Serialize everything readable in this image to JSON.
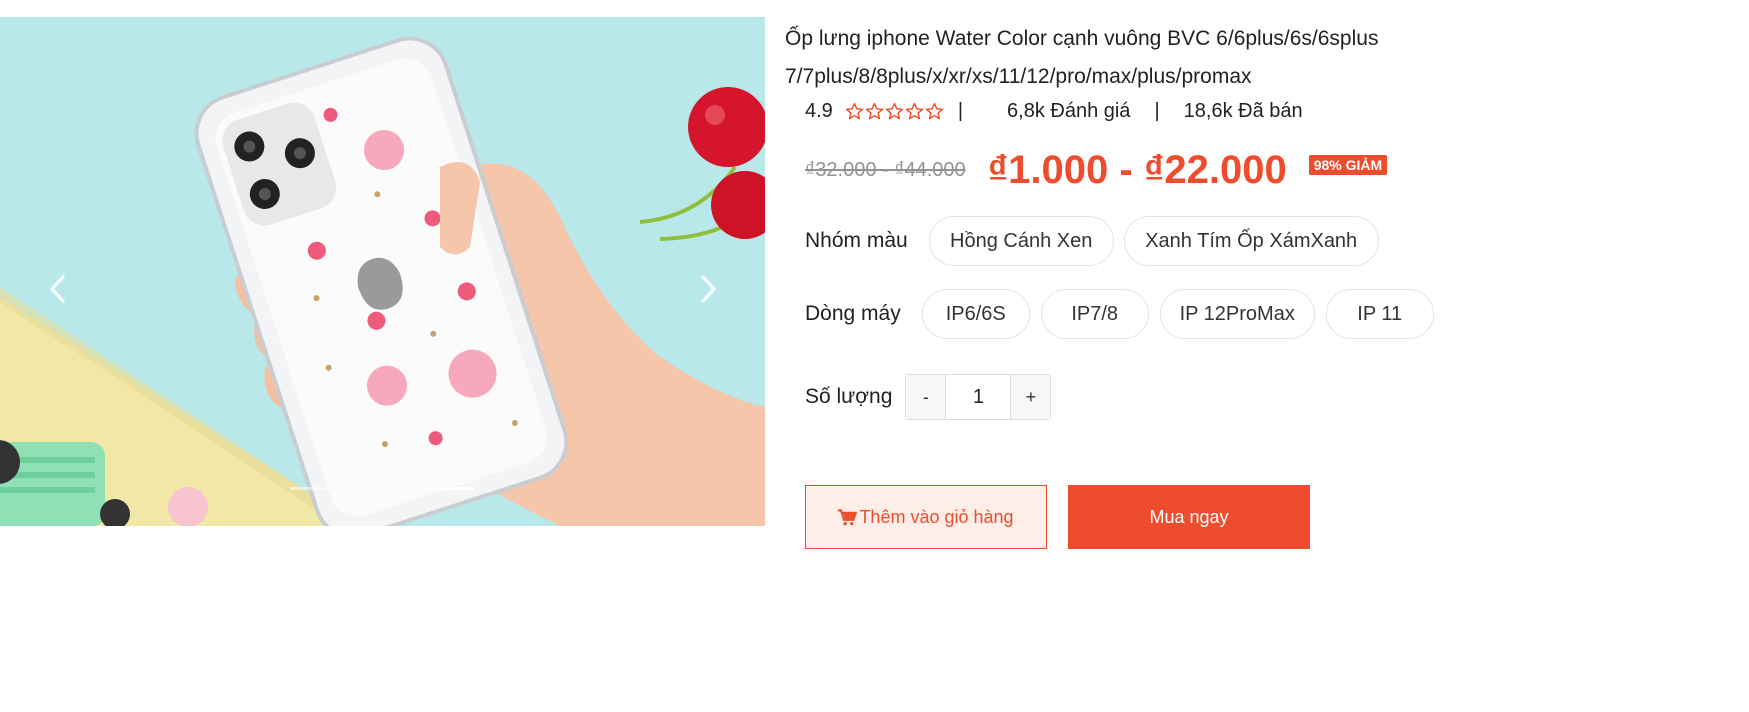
{
  "product": {
    "title": "Ốp lưng iphone Water Color cạnh vuông BVC 6/6plus/6s/6splus 7/7plus/8/8plus/x/xr/xs/11/12/pro/max/plus/promax",
    "rating": "4.9",
    "stars_count": 5,
    "separator": "|",
    "reviews": "6,8k Đánh giá",
    "sold": "18,6k Đã bán",
    "old_price": "₫32.000 - ₫44.000",
    "price": "₫1.000 - ₫22.000",
    "discount": "98% GIẢM"
  },
  "carousel": {
    "image_icon": "phone-case-photo",
    "prev_icon": "chevron-left-icon",
    "next_icon": "chevron-right-icon",
    "slides": 4,
    "active_slide": 4
  },
  "options": {
    "color_label": "Nhóm màu",
    "colors": [
      "Hồng Cánh Xen",
      "Xanh Tím Ốp XámXanh"
    ],
    "model_label": "Dòng máy",
    "models": [
      "IP6/6S",
      "IP7/8",
      "IP 12ProMax",
      "IP 11"
    ]
  },
  "quantity": {
    "label": "Số lượng",
    "minus": "-",
    "value": "1",
    "plus": "+"
  },
  "actions": {
    "add_to_cart": "Thêm vào giỏ hàng",
    "cart_icon": "cart-icon",
    "buy_now": "Mua ngay"
  },
  "colors": {
    "accent": "#ee4d2d",
    "cart_bg": "#ffeee8",
    "old_price": "#929292"
  }
}
